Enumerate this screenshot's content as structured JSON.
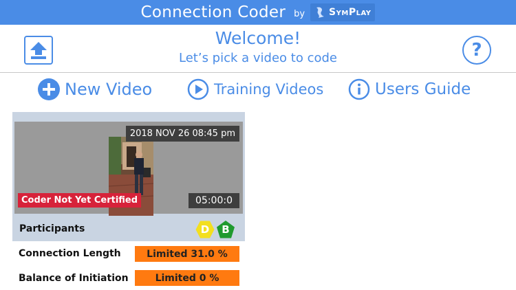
{
  "titlebar": {
    "app_title": "Connection Coder",
    "by_text": "by",
    "logo_text": "SymPlay"
  },
  "header": {
    "welcome": "Welcome!",
    "subtitle": "Let’s pick a video to code",
    "help_glyph": "?",
    "upload_icon": "upload-icon",
    "help_icon": "question-circle-icon"
  },
  "actions": [
    {
      "label": "New Video",
      "icon": "plus-circle-icon"
    },
    {
      "label": "Training Videos",
      "icon": "play-circle-icon"
    },
    {
      "label": "Users Guide",
      "icon": "info-circle-icon"
    }
  ],
  "video_card": {
    "date": "2018 NOV 26 08:45 pm",
    "certification": "Coder Not Yet Certified",
    "duration": "05:00:0",
    "participants_label": "Participants",
    "participants": [
      {
        "letter": "D",
        "color": "#f3df1f"
      },
      {
        "letter": "B",
        "color": "#1f9a2f"
      }
    ],
    "connection_length_label": "Connection Length",
    "connection_length_value": "Limited 31.0 %",
    "balance_label": "Balance of Initiation",
    "balance_value": "Limited 0 %"
  },
  "colors": {
    "accent": "#4a8ce6",
    "warning": "#ff7a10",
    "error": "#d7223a"
  }
}
